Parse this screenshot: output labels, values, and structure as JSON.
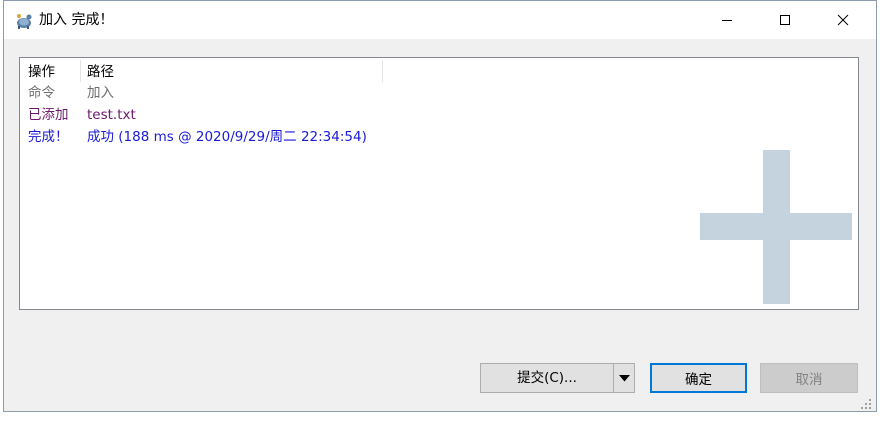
{
  "window": {
    "title": "加入 完成！",
    "controls": {
      "minimize": "minimize",
      "maximize": "maximize",
      "close": "close"
    }
  },
  "log": {
    "columns": {
      "action": "操作",
      "path": "路径"
    },
    "rows": [
      {
        "action": "命令",
        "path": "加入",
        "color": "#6d6d6d"
      },
      {
        "action": "已添加",
        "path": "test.txt",
        "color": "#6b1a6b"
      },
      {
        "action": "完成！",
        "path": "成功 (188 ms @ 2020/9/29/周二 22:34:54)",
        "color": "#1a1ad8"
      }
    ],
    "watermark_icon": "plus-icon",
    "watermark_color": "#c5d3df"
  },
  "buttons": {
    "commit": "提交(C)...",
    "ok": "确定",
    "cancel": "取消"
  }
}
